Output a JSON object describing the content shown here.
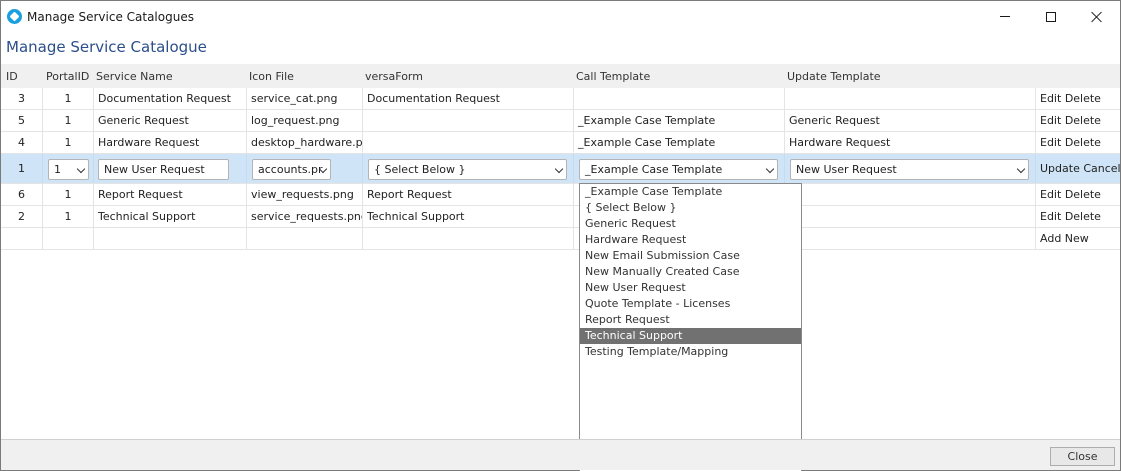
{
  "window": {
    "title": "Manage Service Catalogues"
  },
  "page": {
    "title": "Manage Service Catalogue"
  },
  "columns": {
    "id": "ID",
    "portal_id": "PortalID",
    "service_name": "Service Name",
    "icon_file": "Icon File",
    "versaform": "versaForm",
    "call_template": "Call Template",
    "update_template": "Update Template"
  },
  "rows": [
    {
      "id": "3",
      "portal_id": "1",
      "service_name": "Documentation Request",
      "icon_file": "service_cat.png",
      "versaform": "Documentation Request",
      "call_template": "",
      "update_template": "",
      "edit": "Edit",
      "delete": "Delete"
    },
    {
      "id": "5",
      "portal_id": "1",
      "service_name": "Generic Request",
      "icon_file": "log_request.png",
      "versaform": "",
      "call_template": "_Example Case Template",
      "update_template": "Generic Request",
      "edit": "Edit",
      "delete": "Delete"
    },
    {
      "id": "4",
      "portal_id": "1",
      "service_name": "Hardware Request",
      "icon_file": "desktop_hardware.png",
      "versaform": "",
      "call_template": "_Example Case Template",
      "update_template": "Hardware Request",
      "edit": "Edit",
      "delete": "Delete"
    }
  ],
  "edit_row": {
    "id": "1",
    "portal_id": "1",
    "service_name": "New User Request",
    "icon_file": "accounts.pr",
    "versaform": "{ Select Below }",
    "call_template": "_Example Case Template",
    "update_template": "New User Request",
    "update": "Update",
    "cancel": "Cancel"
  },
  "rows_after": [
    {
      "id": "6",
      "portal_id": "1",
      "service_name": "Report Request",
      "icon_file": "view_requests.png",
      "versaform": "Report Request",
      "edit": "Edit",
      "delete": "Delete"
    },
    {
      "id": "2",
      "portal_id": "1",
      "service_name": "Technical Support",
      "icon_file": "service_requests.png",
      "versaform": "Technical Support",
      "edit": "Edit",
      "delete": "Delete"
    }
  ],
  "add_new": "Add New",
  "dropdown": {
    "options": [
      "_Example Case Template",
      "{ Select Below }",
      "Generic Request",
      "Hardware Request",
      "New Email Submission Case",
      "New Manually Created Case",
      "New User Request",
      "Quote Template - Licenses",
      "Report Request",
      "Technical Support",
      "Testing Template/Mapping"
    ],
    "highlighted": "Technical Support"
  },
  "footer": {
    "close_label": "Close"
  },
  "colors": {
    "accent_title": "#2b4f8a",
    "edit_row_bg": "#cfe5f7",
    "highlight": "#717171"
  }
}
